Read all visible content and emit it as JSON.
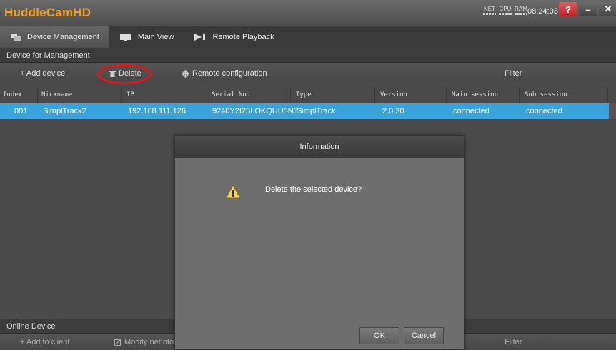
{
  "app": {
    "title": "HuddleCamHD",
    "clock": "08:24:03",
    "help_label": "?",
    "minimize_label": "–",
    "close_label": "✕"
  },
  "meters": [
    {
      "label": "NET"
    },
    {
      "label": "CPU"
    },
    {
      "label": "RAM"
    }
  ],
  "tabs": [
    {
      "label": "Device Management",
      "icon": "devices-icon"
    },
    {
      "label": "Main View",
      "icon": "monitor-icon"
    },
    {
      "label": "Remote Playback",
      "icon": "playback-icon"
    }
  ],
  "managed": {
    "header": "Device for Management",
    "toolbar": {
      "add": "+ Add device",
      "delete": "Delete",
      "remote_config": "Remote configuration",
      "filter": "Filter"
    },
    "columns": [
      "Index",
      "Nickname",
      "IP",
      "Serial No.",
      "Type",
      "Version",
      "Main session",
      "Sub session"
    ],
    "rows": [
      {
        "index": "001",
        "nickname": "SimplTrack2",
        "ip": "192.168.111.126",
        "serial": "9240Y2I25LOKQUU5N3:",
        "type": "SimplTrack",
        "version": "2.0.30",
        "main_session": "connected",
        "sub_session": "connected"
      }
    ]
  },
  "online": {
    "header": "Online Device",
    "toolbar": {
      "add_to_client": "+ Add to client",
      "modify_netinfo": "Modify netInfo",
      "filter": "Filter"
    }
  },
  "dialog": {
    "title": "Information",
    "message": "Delete the selected device?",
    "ok": "OK",
    "cancel": "Cancel",
    "icon": "warning-icon"
  },
  "colors": {
    "accent": "#3aa3dc",
    "logo": "#f0a020",
    "highlight_circle": "#e01818"
  }
}
